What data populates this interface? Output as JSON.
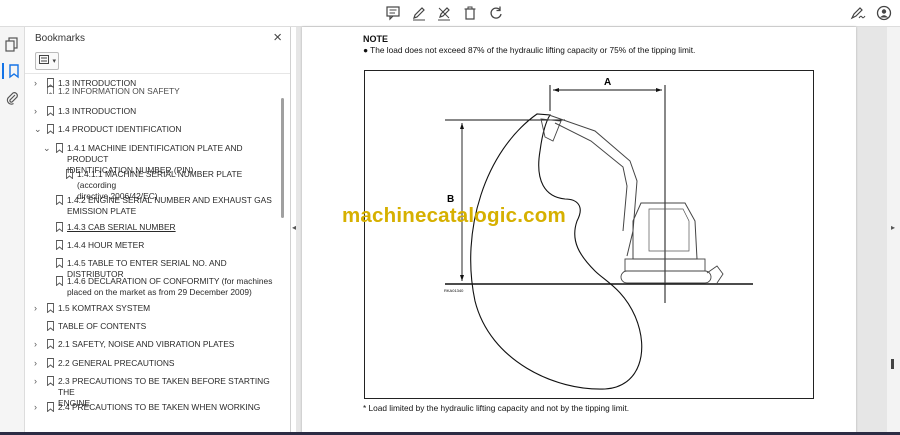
{
  "toolbar": {
    "icons": [
      "comment-icon",
      "pen-icon",
      "highlight-icon",
      "delete-icon",
      "rotate-icon",
      "sign-icon",
      "account-icon"
    ]
  },
  "bookmarks_panel": {
    "title": "Bookmarks",
    "close_label": "×",
    "items": [
      {
        "label": "1.2 INFORMATION ON SAFETY",
        "chev": "",
        "level": 0,
        "clipped": true
      },
      {
        "label": "1.3 INTRODUCTION",
        "chev": "›",
        "level": 0
      },
      {
        "label": "1.2 INFORMATION ON SAFETY",
        "chev": "",
        "level": 0,
        "clipped": true
      },
      {
        "label": "1.3 INTRODUCTION",
        "chev": "›",
        "level": 0
      },
      {
        "label": "1.4 PRODUCT IDENTIFICATION",
        "chev": "⌄",
        "level": 0
      },
      {
        "label": "1.4.1 MACHINE IDENTIFICATION PLATE AND PRODUCT IDENTIFICATION NUMBER (PIN)",
        "line1": "1.4.1 MACHINE IDENTIFICATION PLATE AND PRODUCT",
        "line2": "IDENTIFICATION NUMBER (PIN)",
        "chev": "⌄",
        "level": 1
      },
      {
        "label": "1.4.1.1 MACHINE SERIAL NUMBER PLATE (according directive 2006/42/EC)",
        "line1": "1.4.1.1 MACHINE SERIAL NUMBER PLATE (according",
        "line2": "directive 2006/42/EC)",
        "chev": "",
        "level": 2
      },
      {
        "label": "1.4.2 ENGINE SERIAL NUMBER AND EXHAUST GAS EMISSION PLATE",
        "line1": "1.4.2 ENGINE SERIAL NUMBER AND EXHAUST GAS",
        "line2": "EMISSION PLATE",
        "chev": "",
        "level": 1
      },
      {
        "label": "1.4.3 CAB SERIAL NUMBER",
        "chev": "",
        "level": 1,
        "underline": true
      },
      {
        "label": "1.4.4 HOUR METER",
        "chev": "",
        "level": 1
      },
      {
        "label": "1.4.5 TABLE TO ENTER SERIAL NO. AND DISTRIBUTOR",
        "chev": "",
        "level": 1
      },
      {
        "label": "1.4.6 DECLARATION OF CONFORMITY (for machines placed on the market as from 29 December 2009)",
        "line1": "1.4.6 DECLARATION OF CONFORMITY (for machines",
        "line2": "placed on the market as from 29 December 2009)",
        "chev": "",
        "level": 1
      },
      {
        "label": "1.5 KOMTRAX SYSTEM",
        "chev": "›",
        "level": 0
      },
      {
        "label": "TABLE OF CONTENTS",
        "chev": "",
        "level": 0
      },
      {
        "label": "2.1 SAFETY, NOISE AND VIBRATION PLATES",
        "chev": "›",
        "level": 0
      },
      {
        "label": "2.2 GENERAL PRECAUTIONS",
        "chev": "›",
        "level": 0
      },
      {
        "label": "2.3 PRECAUTIONS TO BE TAKEN BEFORE STARTING THE ENGINE",
        "line1": "2.3 PRECAUTIONS TO BE TAKEN BEFORE STARTING THE",
        "line2": "ENGINE",
        "chev": "›",
        "level": 0
      },
      {
        "label": "2.4 PRECAUTIONS TO BE TAKEN WHEN WORKING",
        "chev": "›",
        "level": 0
      }
    ]
  },
  "document": {
    "note_title": "NOTE",
    "note_text": "● The load does not exceed 87% of the hydraulic lifting capacity or 75% of the tipping limit.",
    "figure_label_a": "A",
    "figure_label_b": "B",
    "figure_code": "RKA01340",
    "footnote": "*  Load limited by the hydraulic lifting capacity and not by the tipping limit.",
    "watermark": "machinecatalogic.com"
  }
}
